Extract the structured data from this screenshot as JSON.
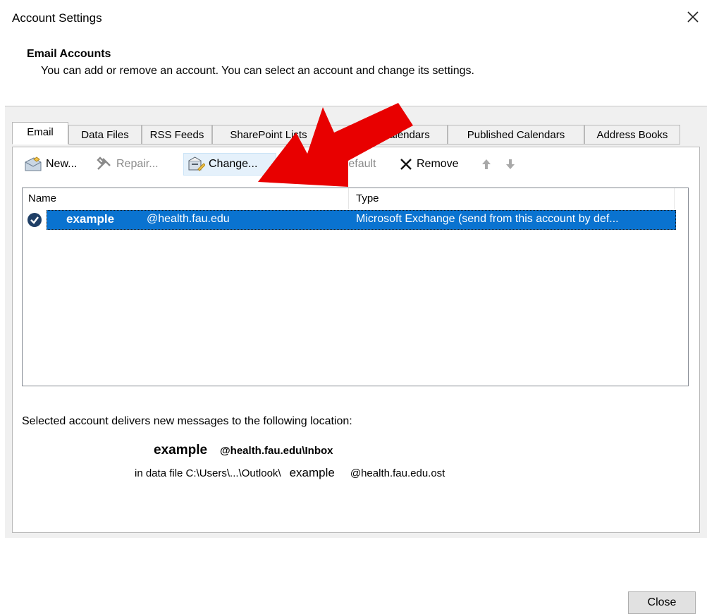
{
  "dialog": {
    "title": "Account Settings",
    "close_label": "Close"
  },
  "section": {
    "title": "Email Accounts",
    "description": "You can add or remove an account. You can select an account and change its settings."
  },
  "tabs": [
    {
      "label": "Email",
      "active": true
    },
    {
      "label": "Data Files",
      "active": false
    },
    {
      "label": "RSS Feeds",
      "active": false
    },
    {
      "label": "SharePoint Lists",
      "active": false
    },
    {
      "label": "Internet Calendars",
      "active": false
    },
    {
      "label": "Published Calendars",
      "active": false
    },
    {
      "label": "Address Books",
      "active": false
    }
  ],
  "toolbar": {
    "new_label": "New...",
    "repair_label": "Repair...",
    "change_label": "Change...",
    "default_label": "Set as Default",
    "remove_label": "Remove"
  },
  "list": {
    "col_name": "Name",
    "col_type": "Type",
    "rows": [
      {
        "name_bold": "example",
        "name_domain": "@health.fau.edu",
        "type": "Microsoft Exchange (send from this account by def..."
      }
    ]
  },
  "delivery": {
    "caption": "Selected account delivers new messages to the following location:",
    "inbox_name": "example",
    "inbox_path": "@health.fau.edu\\Inbox",
    "datafile_prefix": "in data file C:\\Users\\...\\Outlook\\",
    "datafile_name": "example",
    "datafile_suffix": "@health.fau.edu.ost"
  },
  "colors": {
    "selection": "#0a73d0",
    "arrow": "#e80000"
  }
}
